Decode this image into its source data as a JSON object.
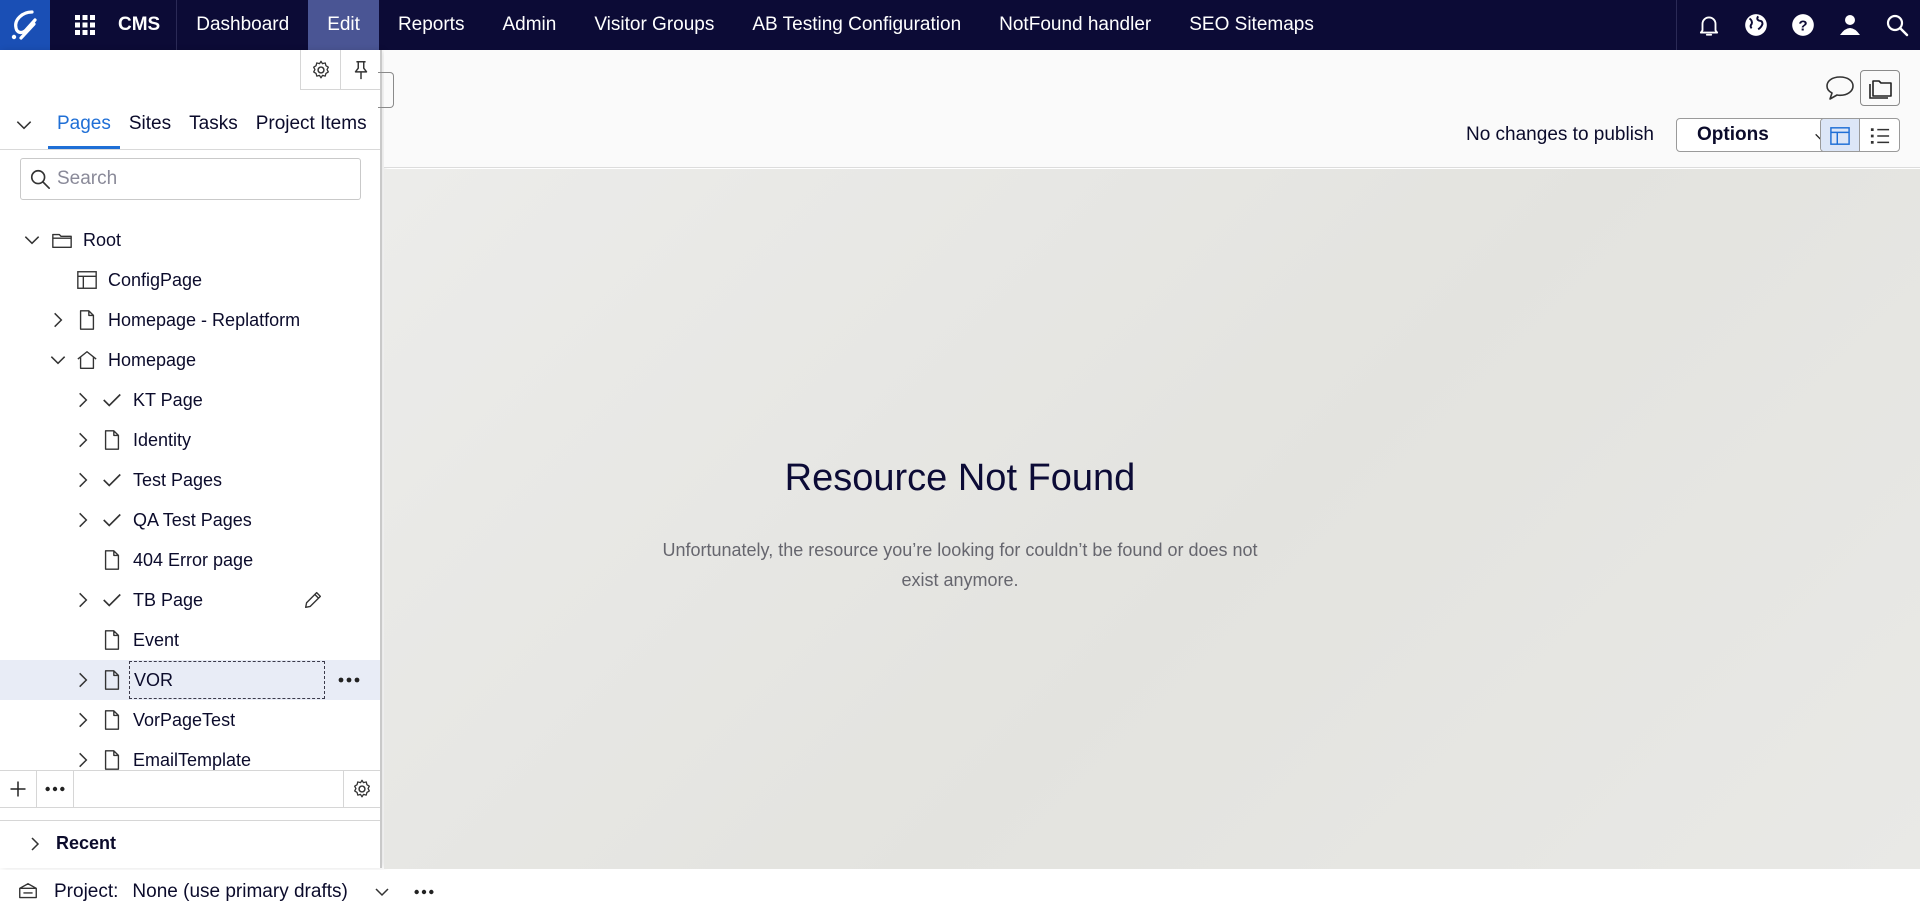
{
  "app": {
    "name": "CMS"
  },
  "nav": {
    "items": [
      {
        "label": "Dashboard",
        "active": false
      },
      {
        "label": "Edit",
        "active": true
      },
      {
        "label": "Reports",
        "active": false
      },
      {
        "label": "Admin",
        "active": false
      },
      {
        "label": "Visitor Groups",
        "active": false
      },
      {
        "label": "AB Testing Configuration",
        "active": false
      },
      {
        "label": "NotFound handler",
        "active": false
      },
      {
        "label": "SEO Sitemaps",
        "active": false
      }
    ],
    "icons": [
      "bell-icon",
      "globe-icon",
      "help-icon",
      "user-icon",
      "search-icon"
    ]
  },
  "panel": {
    "tabs": [
      {
        "label": "Pages",
        "active": true
      },
      {
        "label": "Sites",
        "active": false
      },
      {
        "label": "Tasks",
        "active": false
      },
      {
        "label": "Project Items",
        "active": false
      }
    ],
    "search": {
      "placeholder": "Search",
      "value": ""
    },
    "tree": [
      {
        "label": "Root",
        "level": 0,
        "expander": "expanded",
        "icon": "folder-icon"
      },
      {
        "label": "ConfigPage",
        "level": 1,
        "expander": "none",
        "icon": "layout-icon"
      },
      {
        "label": "Homepage - Replatform",
        "level": 1,
        "expander": "collapsed",
        "icon": "page-icon"
      },
      {
        "label": "Homepage",
        "level": 1,
        "expander": "expanded",
        "icon": "home-icon"
      },
      {
        "label": "KT Page",
        "level": 2,
        "expander": "collapsed",
        "icon": "check-icon"
      },
      {
        "label": "Identity",
        "level": 2,
        "expander": "collapsed",
        "icon": "page-icon"
      },
      {
        "label": "Test Pages",
        "level": 2,
        "expander": "collapsed",
        "icon": "check-icon"
      },
      {
        "label": "QA Test Pages",
        "level": 2,
        "expander": "collapsed",
        "icon": "check-icon"
      },
      {
        "label": "404 Error page",
        "level": 2,
        "expander": "none",
        "icon": "page-icon"
      },
      {
        "label": "TB Page",
        "level": 2,
        "expander": "collapsed",
        "icon": "check-icon",
        "hover_action": "edit-icon"
      },
      {
        "label": "Event",
        "level": 2,
        "expander": "none",
        "icon": "page-icon"
      },
      {
        "label": "VOR",
        "level": 2,
        "expander": "collapsed",
        "icon": "page-icon",
        "selected": true,
        "hover_action": "more-icon"
      },
      {
        "label": "VorPageTest",
        "level": 2,
        "expander": "collapsed",
        "icon": "page-icon"
      },
      {
        "label": "EmailTemplate",
        "level": 2,
        "expander": "collapsed",
        "icon": "page-icon"
      }
    ],
    "recent_label": "Recent"
  },
  "toolbar": {
    "publish_status": "No changes to publish",
    "options_label": "Options"
  },
  "preview": {
    "title": "Resource Not Found",
    "message": "Unfortunately, the resource you’re looking for couldn’t be found or does not exist anymore."
  },
  "status": {
    "project_label": "Project:",
    "project_value": "None (use primary drafts)"
  },
  "colors": {
    "topbar": "#0c0b36",
    "logo": "#1a4fb5",
    "active_nav": "#4a5594",
    "accent": "#1f6fd6",
    "selected_row": "#e8ecf6"
  }
}
